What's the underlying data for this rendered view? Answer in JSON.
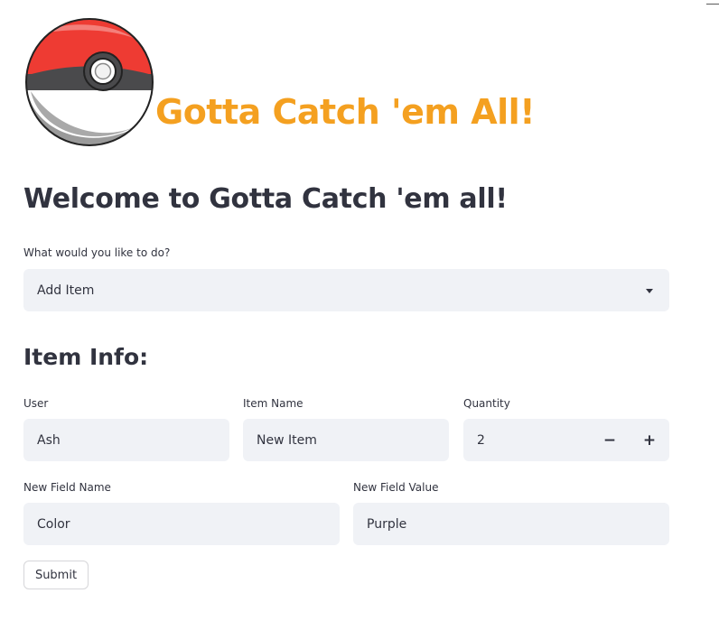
{
  "header": {
    "logo_icon": "pokeball-icon",
    "title": "Gotta Catch 'em All!",
    "accent_color": "#f4a020"
  },
  "main": {
    "welcome_heading": "Welcome to Gotta Catch 'em all!",
    "action_select": {
      "label": "What would you like to do?",
      "value": "Add Item",
      "icon": "chevron-down-icon"
    },
    "section_heading": "Item Info:",
    "fields": {
      "user": {
        "label": "User",
        "value": "Ash"
      },
      "item_name": {
        "label": "Item Name",
        "value": "New Item"
      },
      "quantity": {
        "label": "Quantity",
        "value": "2",
        "decrement": "−",
        "increment": "+"
      },
      "new_field_name": {
        "label": "New Field Name",
        "value": "Color"
      },
      "new_field_value": {
        "label": "New Field Value",
        "value": "Purple"
      }
    },
    "submit_label": "Submit"
  }
}
